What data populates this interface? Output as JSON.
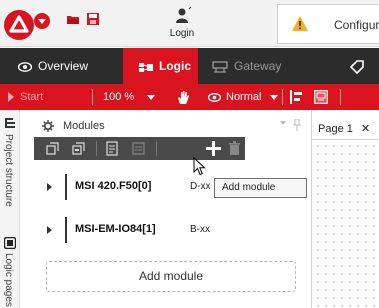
{
  "titlebar": {
    "login_label": "Login",
    "config_text": "Configuration"
  },
  "tabs": [
    {
      "label": "Overview"
    },
    {
      "label": "Logic"
    },
    {
      "label": "Gateway"
    }
  ],
  "toolbar": {
    "start_label": "Start",
    "zoom": "100 %",
    "mode_label": "Normal"
  },
  "sidebar": {
    "project_structure": "Project structure",
    "logic_pages": "Logic pages"
  },
  "modules_panel": {
    "title": "Modules",
    "modules": [
      {
        "name": "MSI 420.F50[0]",
        "type": "D-xx"
      },
      {
        "name": "MSI-EM-IO84[1]",
        "type": "B-xx"
      }
    ],
    "tooltip": "Add module",
    "add_module_label": "Add module"
  },
  "page_tab": {
    "label": "Page 1",
    "close": "✕"
  },
  "colors": {
    "brand_red": "#d9141e",
    "dark_bar": "#2c2c2c",
    "tool_bar": "#4a4a4a"
  }
}
